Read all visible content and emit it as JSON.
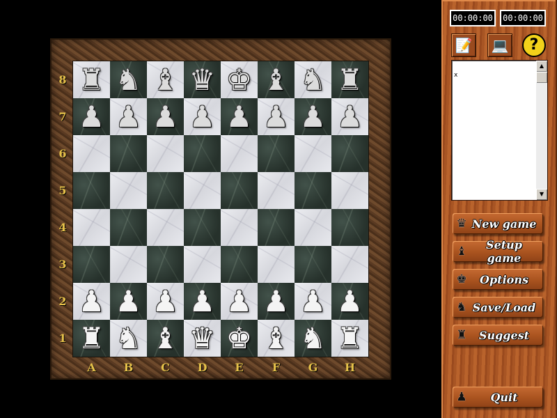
{
  "board": {
    "files": [
      "A",
      "B",
      "C",
      "D",
      "E",
      "F",
      "G",
      "H"
    ],
    "ranks": [
      "8",
      "7",
      "6",
      "5",
      "4",
      "3",
      "2",
      "1"
    ],
    "rows": [
      [
        "r",
        "n",
        "b",
        "q",
        "k",
        "b",
        "n",
        "r"
      ],
      [
        "p",
        "p",
        "p",
        "p",
        "p",
        "p",
        "p",
        "p"
      ],
      [
        "",
        "",
        "",
        "",
        "",
        "",
        "",
        ""
      ],
      [
        "",
        "",
        "",
        "",
        "",
        "",
        "",
        ""
      ],
      [
        "",
        "",
        "",
        "",
        "",
        "",
        "",
        ""
      ],
      [
        "",
        "",
        "",
        "",
        "",
        "",
        "",
        ""
      ],
      [
        "P",
        "P",
        "P",
        "P",
        "P",
        "P",
        "P",
        "P"
      ],
      [
        "R",
        "N",
        "B",
        "Q",
        "K",
        "B",
        "N",
        "R"
      ]
    ]
  },
  "clocks": {
    "white": "00:00:00",
    "black": "00:00:00"
  },
  "toolbar": [
    {
      "name": "notes-icon",
      "glyph": "📝"
    },
    {
      "name": "computer-icon",
      "glyph": "💻"
    },
    {
      "name": "help-icon",
      "glyph": "?"
    }
  ],
  "move_list": {
    "text": "x"
  },
  "menu": {
    "new_game": {
      "label": "New game",
      "icon": "♛"
    },
    "setup_game": {
      "label": "Setup game",
      "icon": "♝"
    },
    "options": {
      "label": "Options",
      "icon": "♚"
    },
    "save_load": {
      "label": "Save/Load",
      "icon": "♞"
    },
    "suggest": {
      "label": "Suggest",
      "icon": "♜"
    },
    "quit": {
      "label": "Quit",
      "icon": "♟"
    }
  },
  "colors": {
    "label_gold": "#e6c24a",
    "panel_wood": "#b9632c",
    "background": "#000000"
  }
}
